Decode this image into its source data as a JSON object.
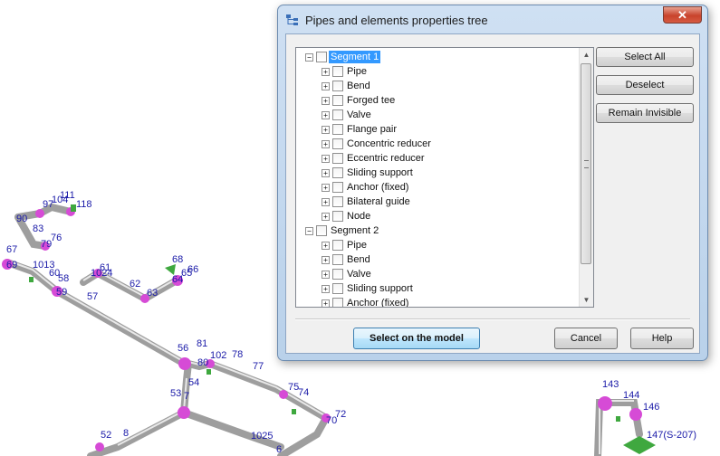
{
  "window": {
    "title": "Pipes and elements properties tree",
    "close_glyph": "✕",
    "icon": "tree-structure-icon"
  },
  "tree": {
    "segments": [
      {
        "label": "Segment 1",
        "selected": true,
        "children": [
          "Pipe",
          "Bend",
          "Forged tee",
          "Valve",
          "Flange pair",
          "Concentric reducer",
          "Eccentric reducer",
          "Sliding support",
          "Anchor (fixed)",
          "Bilateral guide",
          "Node"
        ]
      },
      {
        "label": "Segment 2",
        "selected": false,
        "children": [
          "Pipe",
          "Bend",
          "Valve",
          "Sliding support",
          "Anchor (fixed)"
        ]
      }
    ],
    "expand_glyph": "+",
    "collapse_glyph": "−"
  },
  "buttons": {
    "select_all": "Select All",
    "deselect": "Deselect",
    "remain_invisible": "Remain Invisible",
    "select_on_model": "Select on the model",
    "cancel": "Cancel",
    "help": "Help"
  },
  "model_labels": [
    "111",
    "97",
    "104",
    "118",
    "90",
    "83",
    "76",
    "67",
    "79",
    "69",
    "1013",
    "60",
    "58",
    "59",
    "61",
    "1024",
    "57",
    "62",
    "63",
    "68",
    "65",
    "66",
    "64",
    "81",
    "56",
    "77",
    "102",
    "78",
    "80",
    "54",
    "53",
    "7",
    "75",
    "74",
    "72",
    "70",
    "1025",
    "6",
    "52",
    "8",
    "143",
    "144",
    "146",
    "147(S-207)"
  ],
  "colors": {
    "pipe": "#b4b4b4",
    "bend": "#d64bd6",
    "node_label": "#1a1aa8",
    "support": "#3fa83f",
    "dialog_frame": "#bcd3ec",
    "selection": "#3399ff"
  }
}
